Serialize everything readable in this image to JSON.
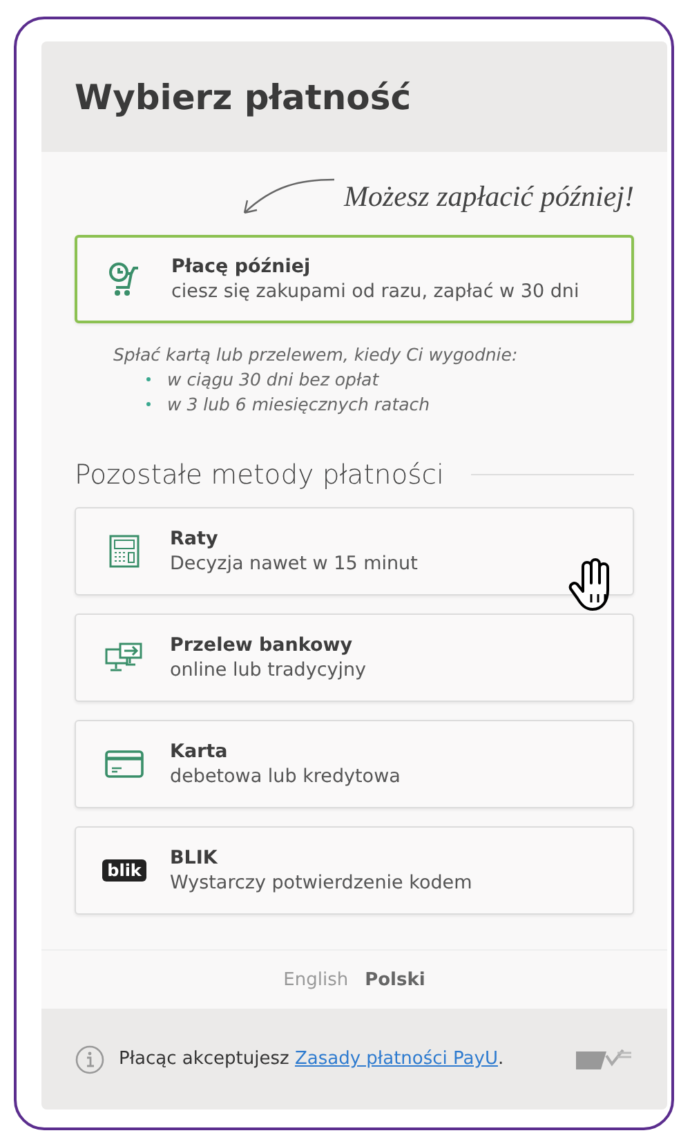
{
  "title": "Wybierz płatność",
  "annotation": "Możesz zapłacić później!",
  "featured_option": {
    "kind": "clock-cart",
    "name": "Płacę później",
    "description": "ciesz się zakupami od razu, zapłać w 30 dni",
    "selected": true
  },
  "featured_info": {
    "lead": "Spłać kartą lub przelewem, kiedy Ci wygodnie:",
    "bullets": [
      "w ciągu 30 dni bez opłat",
      "w 3 lub 6 miesięcznych ratach"
    ]
  },
  "section_title": "Pozostałe metody płatności",
  "payment_options": [
    {
      "kind": "calculator",
      "name": "Raty",
      "description": "Decyzja nawet w 15 minut",
      "selected": false
    },
    {
      "kind": "transfer",
      "name": "Przelew bankowy",
      "description": "online lub tradycyjny",
      "selected": false
    },
    {
      "kind": "card",
      "name": "Karta",
      "description": "debetowa lub kredytowa",
      "selected": false
    },
    {
      "kind": "blik",
      "logo_text": "blik",
      "name": "BLIK",
      "description": "Wystarczy potwierdzenie kodem",
      "selected": false
    }
  ],
  "languages": [
    {
      "label": "English",
      "selected": false
    },
    {
      "label": "Polski",
      "selected": true
    }
  ],
  "footer": {
    "text": "Płacąc akceptujesz",
    "link": "Zasady płatności PayU",
    "after": "."
  }
}
